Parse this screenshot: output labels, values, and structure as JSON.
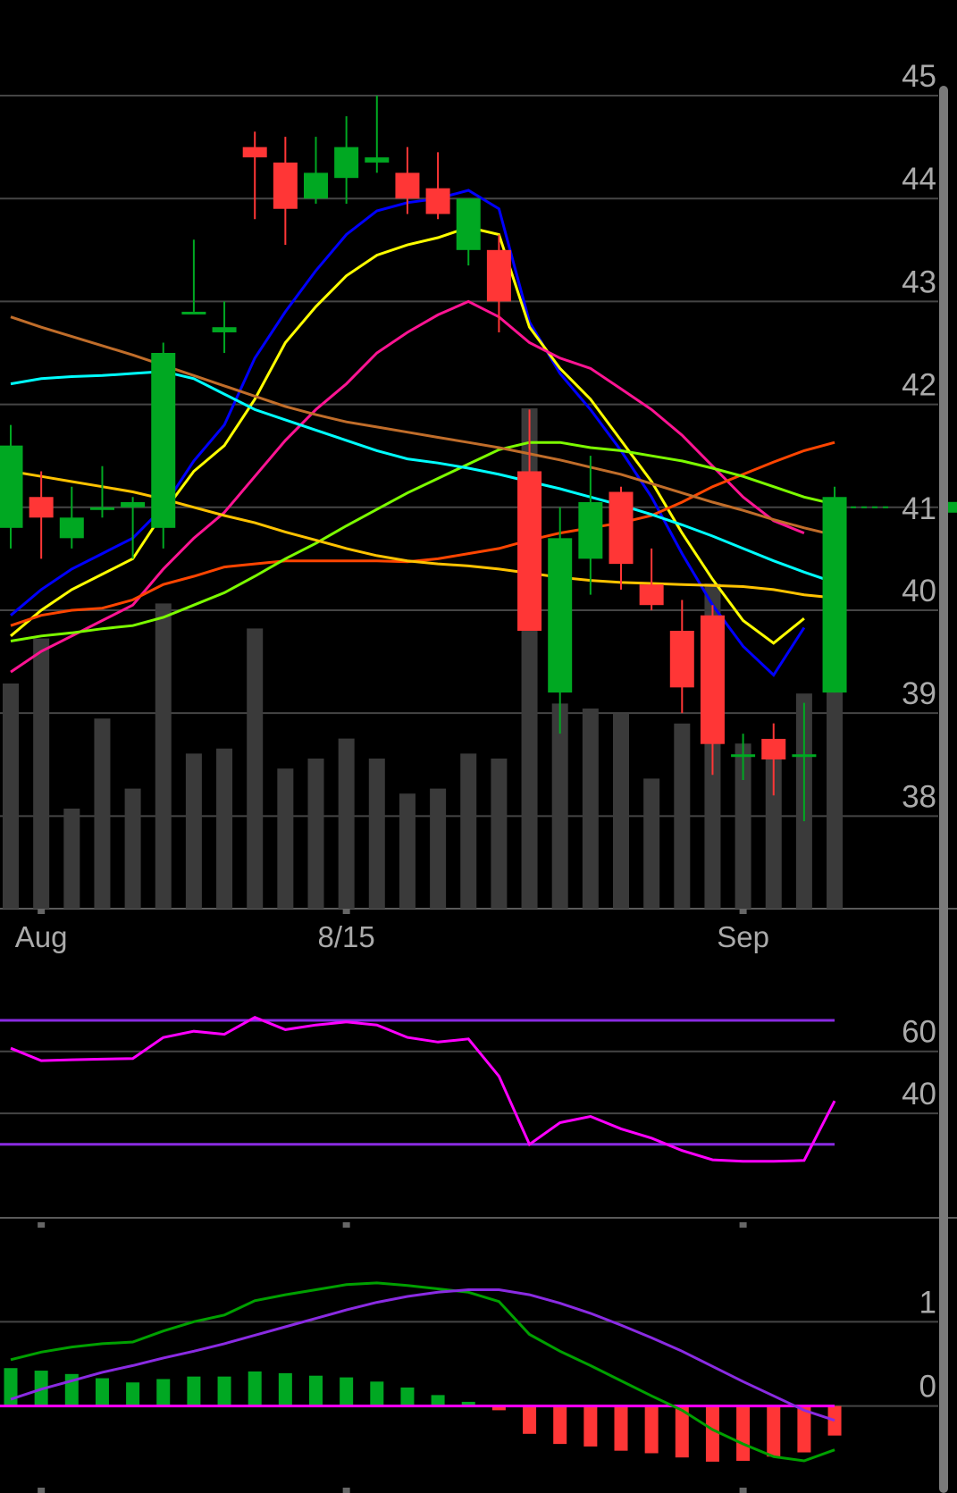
{
  "chart_data": [
    {
      "type": "candlestick",
      "panel": "price",
      "y_ticks": [
        "45",
        "44",
        "43",
        "42",
        "41",
        "40",
        "39",
        "38"
      ],
      "y_range": [
        37.1,
        45.2
      ],
      "x_labels": [
        {
          "label": "Aug",
          "index": 1
        },
        {
          "label": "8/15",
          "index": 11
        },
        {
          "label": "Sep",
          "index": 24
        }
      ],
      "last_price": 41,
      "candles": [
        {
          "o": 40.8,
          "h": 41.8,
          "l": 40.6,
          "c": 41.6
        },
        {
          "o": 41.1,
          "h": 41.35,
          "l": 40.5,
          "c": 40.9
        },
        {
          "o": 40.7,
          "h": 41.2,
          "l": 40.6,
          "c": 40.9
        },
        {
          "o": 41.0,
          "h": 41.4,
          "l": 40.9,
          "c": 41.0
        },
        {
          "o": 41.0,
          "h": 41.1,
          "l": 40.5,
          "c": 41.05
        },
        {
          "o": 40.8,
          "h": 42.6,
          "l": 40.6,
          "c": 42.5
        },
        {
          "o": 42.9,
          "h": 43.6,
          "l": 42.9,
          "c": 42.9
        },
        {
          "o": 42.7,
          "h": 43.0,
          "l": 42.5,
          "c": 42.75
        },
        {
          "o": 44.5,
          "h": 44.65,
          "l": 43.8,
          "c": 44.4
        },
        {
          "o": 44.35,
          "h": 44.6,
          "l": 43.55,
          "c": 43.9
        },
        {
          "o": 44.0,
          "h": 44.6,
          "l": 43.95,
          "c": 44.25
        },
        {
          "o": 44.2,
          "h": 44.8,
          "l": 43.95,
          "c": 44.5
        },
        {
          "o": 44.35,
          "h": 45.0,
          "l": 44.25,
          "c": 44.4
        },
        {
          "o": 44.25,
          "h": 44.5,
          "l": 43.85,
          "c": 44.0
        },
        {
          "o": 44.1,
          "h": 44.45,
          "l": 43.8,
          "c": 43.85
        },
        {
          "o": 43.5,
          "h": 44.0,
          "l": 43.35,
          "c": 44.0
        },
        {
          "o": 43.5,
          "h": 43.65,
          "l": 42.7,
          "c": 43.0
        },
        {
          "o": 41.35,
          "h": 41.95,
          "l": 39.8,
          "c": 39.8
        },
        {
          "o": 39.2,
          "h": 41.0,
          "l": 38.8,
          "c": 40.7
        },
        {
          "o": 40.5,
          "h": 41.5,
          "l": 40.15,
          "c": 41.05
        },
        {
          "o": 41.15,
          "h": 41.2,
          "l": 40.2,
          "c": 40.45
        },
        {
          "o": 40.25,
          "h": 40.6,
          "l": 40.0,
          "c": 40.05
        },
        {
          "o": 39.8,
          "h": 40.1,
          "l": 39.0,
          "c": 39.25
        },
        {
          "o": 39.95,
          "h": 40.05,
          "l": 38.4,
          "c": 38.7
        },
        {
          "o": 38.6,
          "h": 38.8,
          "l": 38.35,
          "c": 38.6
        },
        {
          "o": 38.75,
          "h": 38.9,
          "l": 38.2,
          "c": 38.55
        },
        {
          "o": 38.6,
          "h": 39.1,
          "l": 37.95,
          "c": 38.6
        },
        {
          "o": 39.2,
          "h": 41.2,
          "l": 39.2,
          "c": 41.1
        }
      ],
      "volume": [
        0.45,
        0.54,
        0.2,
        0.38,
        0.24,
        0.61,
        0.31,
        0.32,
        0.56,
        0.28,
        0.3,
        0.34,
        0.3,
        0.23,
        0.24,
        0.31,
        0.3,
        1.0,
        0.41,
        0.4,
        0.39,
        0.26,
        0.37,
        0.65,
        0.33,
        0.3,
        0.43,
        0.46
      ],
      "moving_averages": [
        {
          "color": "#0000ff",
          "values": [
            39.95,
            40.2,
            40.4,
            40.55,
            40.7,
            41.0,
            41.45,
            41.8,
            42.45,
            42.9,
            43.3,
            43.65,
            43.88,
            43.96,
            44.0,
            44.08,
            43.9,
            42.8,
            42.3,
            41.95,
            41.55,
            41.1,
            40.55,
            40.05,
            39.65,
            39.37,
            39.83
          ]
        },
        {
          "color": "#ffff00",
          "values": [
            39.75,
            40.0,
            40.2,
            40.35,
            40.5,
            40.95,
            41.35,
            41.6,
            42.05,
            42.6,
            42.95,
            43.25,
            43.45,
            43.55,
            43.62,
            43.72,
            43.65,
            42.75,
            42.35,
            42.05,
            41.65,
            41.25,
            40.75,
            40.3,
            39.9,
            39.68,
            39.92
          ]
        },
        {
          "color": "#ff1493",
          "values": [
            39.4,
            39.6,
            39.75,
            39.9,
            40.05,
            40.4,
            40.7,
            40.95,
            41.3,
            41.65,
            41.95,
            42.2,
            42.5,
            42.7,
            42.87,
            43.0,
            42.85,
            42.6,
            42.45,
            42.35,
            42.15,
            41.95,
            41.7,
            41.4,
            41.1,
            40.87,
            40.75
          ]
        },
        {
          "color": "#ff4500",
          "values": [
            39.85,
            39.95,
            40.0,
            40.02,
            40.1,
            40.25,
            40.33,
            40.42,
            40.45,
            40.48,
            40.48,
            40.48,
            40.48,
            40.47,
            40.5,
            40.55,
            40.6,
            40.68,
            40.75,
            40.8,
            40.85,
            40.92,
            41.05,
            41.2,
            41.32,
            41.44,
            41.55,
            41.63
          ]
        },
        {
          "color": "#7cfc00",
          "values": [
            39.7,
            39.75,
            39.78,
            39.82,
            39.85,
            39.93,
            40.05,
            40.17,
            40.33,
            40.5,
            40.65,
            40.82,
            40.98,
            41.14,
            41.28,
            41.42,
            41.56,
            41.63,
            41.63,
            41.58,
            41.55,
            41.5,
            41.45,
            41.38,
            41.3,
            41.2,
            41.1,
            41.03
          ]
        },
        {
          "color": "#00ffff",
          "values": [
            42.2,
            42.25,
            42.27,
            42.28,
            42.3,
            42.32,
            42.25,
            42.1,
            41.95,
            41.85,
            41.75,
            41.65,
            41.55,
            41.47,
            41.43,
            41.38,
            41.32,
            41.25,
            41.18,
            41.1,
            41.02,
            40.93,
            40.83,
            40.72,
            40.6,
            40.48,
            40.37,
            40.27
          ]
        },
        {
          "color": "#ffc200",
          "values": [
            41.35,
            41.3,
            41.25,
            41.2,
            41.15,
            41.08,
            41.0,
            40.92,
            40.85,
            40.76,
            40.68,
            40.6,
            40.53,
            40.48,
            40.45,
            40.43,
            40.4,
            40.36,
            40.32,
            40.29,
            40.27,
            40.26,
            40.25,
            40.24,
            40.23,
            40.2,
            40.15,
            40.12
          ]
        },
        {
          "color": "#c06d2a",
          "values": [
            42.85,
            42.75,
            42.66,
            42.57,
            42.48,
            42.38,
            42.28,
            42.18,
            42.08,
            41.98,
            41.9,
            41.83,
            41.78,
            41.73,
            41.68,
            41.63,
            41.58,
            41.52,
            41.46,
            41.39,
            41.32,
            41.23,
            41.14,
            41.05,
            40.97,
            40.88,
            40.8,
            40.73
          ]
        }
      ]
    },
    {
      "type": "line",
      "panel": "oscillator",
      "y_ticks": [
        "60",
        "40"
      ],
      "y_range": [
        6,
        85
      ],
      "bands": [
        70,
        30
      ],
      "series": [
        {
          "color": "#ff00ff",
          "values": [
            61,
            57,
            57.3,
            57.5,
            57.7,
            64.5,
            66.5,
            65.5,
            71,
            67,
            68.5,
            69.5,
            68.5,
            64.5,
            63,
            64,
            52,
            30,
            37,
            39,
            35,
            32,
            28,
            25,
            24.5,
            24.5,
            24.8,
            44
          ]
        }
      ]
    },
    {
      "type": "bar",
      "panel": "macd",
      "y_ticks": [
        "1",
        "0"
      ],
      "y_range": [
        -1.0,
        2.0
      ],
      "histogram": [
        0.45,
        0.42,
        0.38,
        0.33,
        0.28,
        0.32,
        0.35,
        0.35,
        0.41,
        0.39,
        0.36,
        0.34,
        0.29,
        0.22,
        0.13,
        0.05,
        -0.05,
        -0.33,
        -0.45,
        -0.48,
        -0.53,
        -0.56,
        -0.61,
        -0.66,
        -0.65,
        -0.6,
        -0.55,
        -0.35
      ],
      "lines": [
        {
          "color": "#00a000",
          "values": [
            0.55,
            0.64,
            0.7,
            0.74,
            0.76,
            0.89,
            1.0,
            1.08,
            1.25,
            1.32,
            1.38,
            1.44,
            1.46,
            1.43,
            1.39,
            1.35,
            1.24,
            0.85,
            0.65,
            0.48,
            0.3,
            0.12,
            -0.05,
            -0.28,
            -0.45,
            -0.6,
            -0.65,
            -0.52
          ]
        },
        {
          "color": "#8a2be2",
          "values": [
            0.08,
            0.2,
            0.3,
            0.4,
            0.48,
            0.57,
            0.65,
            0.74,
            0.84,
            0.94,
            1.04,
            1.14,
            1.23,
            1.3,
            1.35,
            1.38,
            1.38,
            1.32,
            1.22,
            1.1,
            0.96,
            0.81,
            0.65,
            0.47,
            0.29,
            0.12,
            -0.05,
            -0.17
          ]
        }
      ]
    }
  ]
}
